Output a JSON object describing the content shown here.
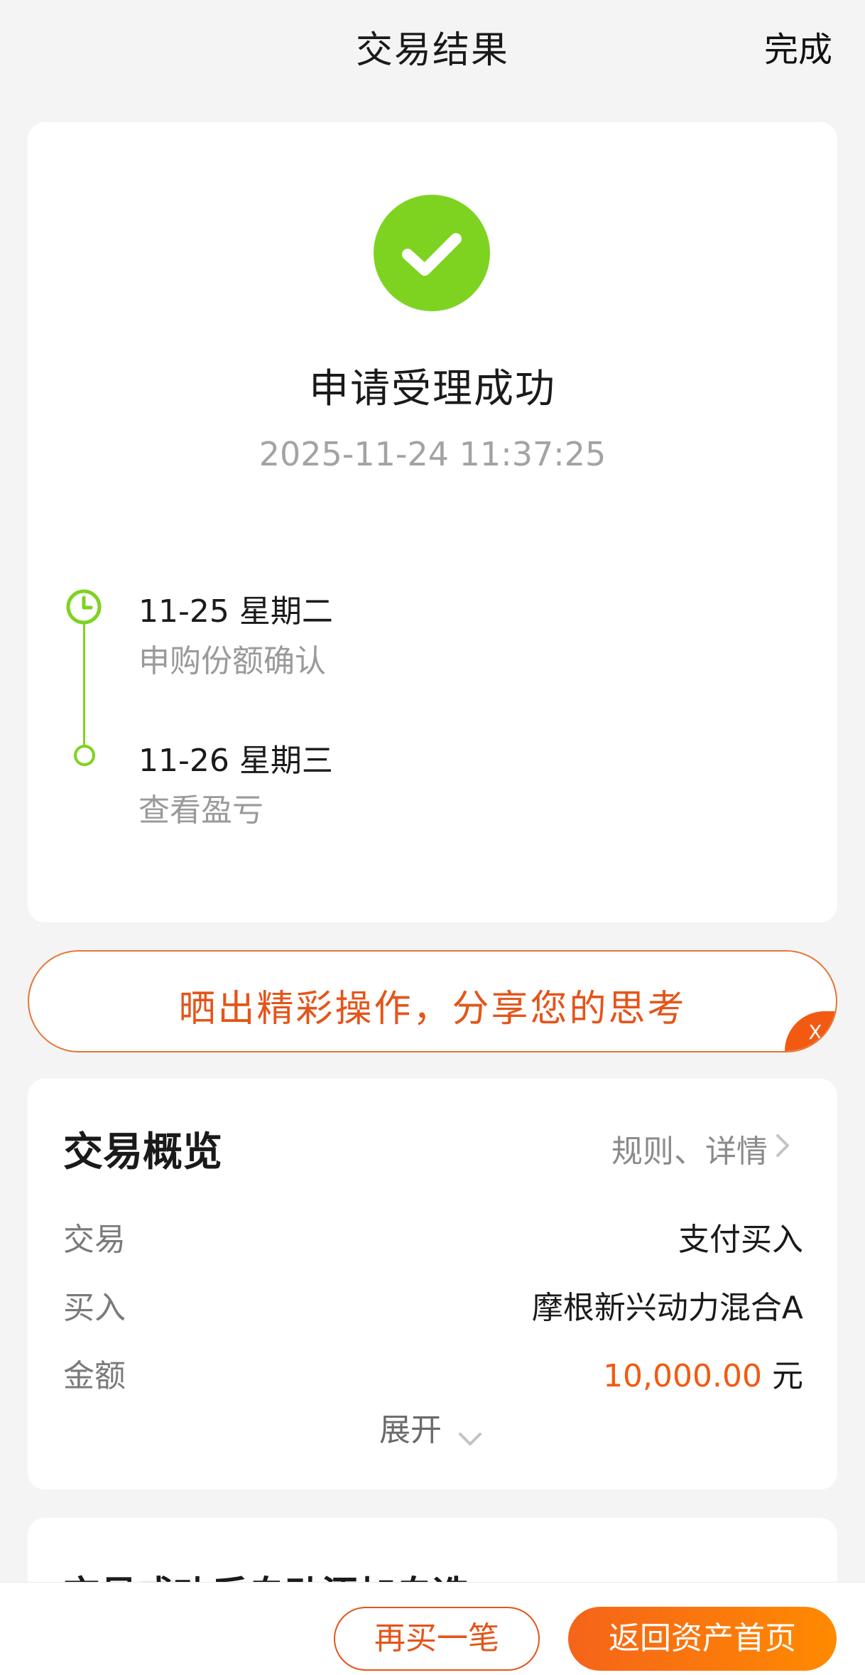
{
  "header": {
    "title": "交易结果",
    "done_label": "完成"
  },
  "result": {
    "status_icon": "check-circle-icon",
    "title": "申请受理成功",
    "time": "2025-11-24 11:37:25",
    "timeline": [
      {
        "date": "11-25  星期二",
        "desc": "申购份额确认",
        "icon": "clock-icon"
      },
      {
        "date": "11-26  星期三",
        "desc": "查看盈亏",
        "icon": "dot-icon"
      }
    ],
    "accent_color": "#7ed321"
  },
  "share_banner": {
    "text": "晒出精彩操作，分享您的思考",
    "close_label": "X"
  },
  "overview": {
    "title": "交易概览",
    "rules_link": "规则、详情",
    "rows": [
      {
        "label": "交易",
        "value": "支付买入"
      },
      {
        "label": "买入",
        "value": "摩根新兴动力混合A"
      },
      {
        "label": "金额",
        "amount": "10,000.00",
        "unit": " 元"
      }
    ],
    "expand_label": "展开",
    "amount_color": "#f25a12"
  },
  "next_card": {
    "title": "交易成功后自动添加自选"
  },
  "bottom": {
    "buy_again_label": "再买一笔",
    "home_label": "返回资产首页"
  }
}
